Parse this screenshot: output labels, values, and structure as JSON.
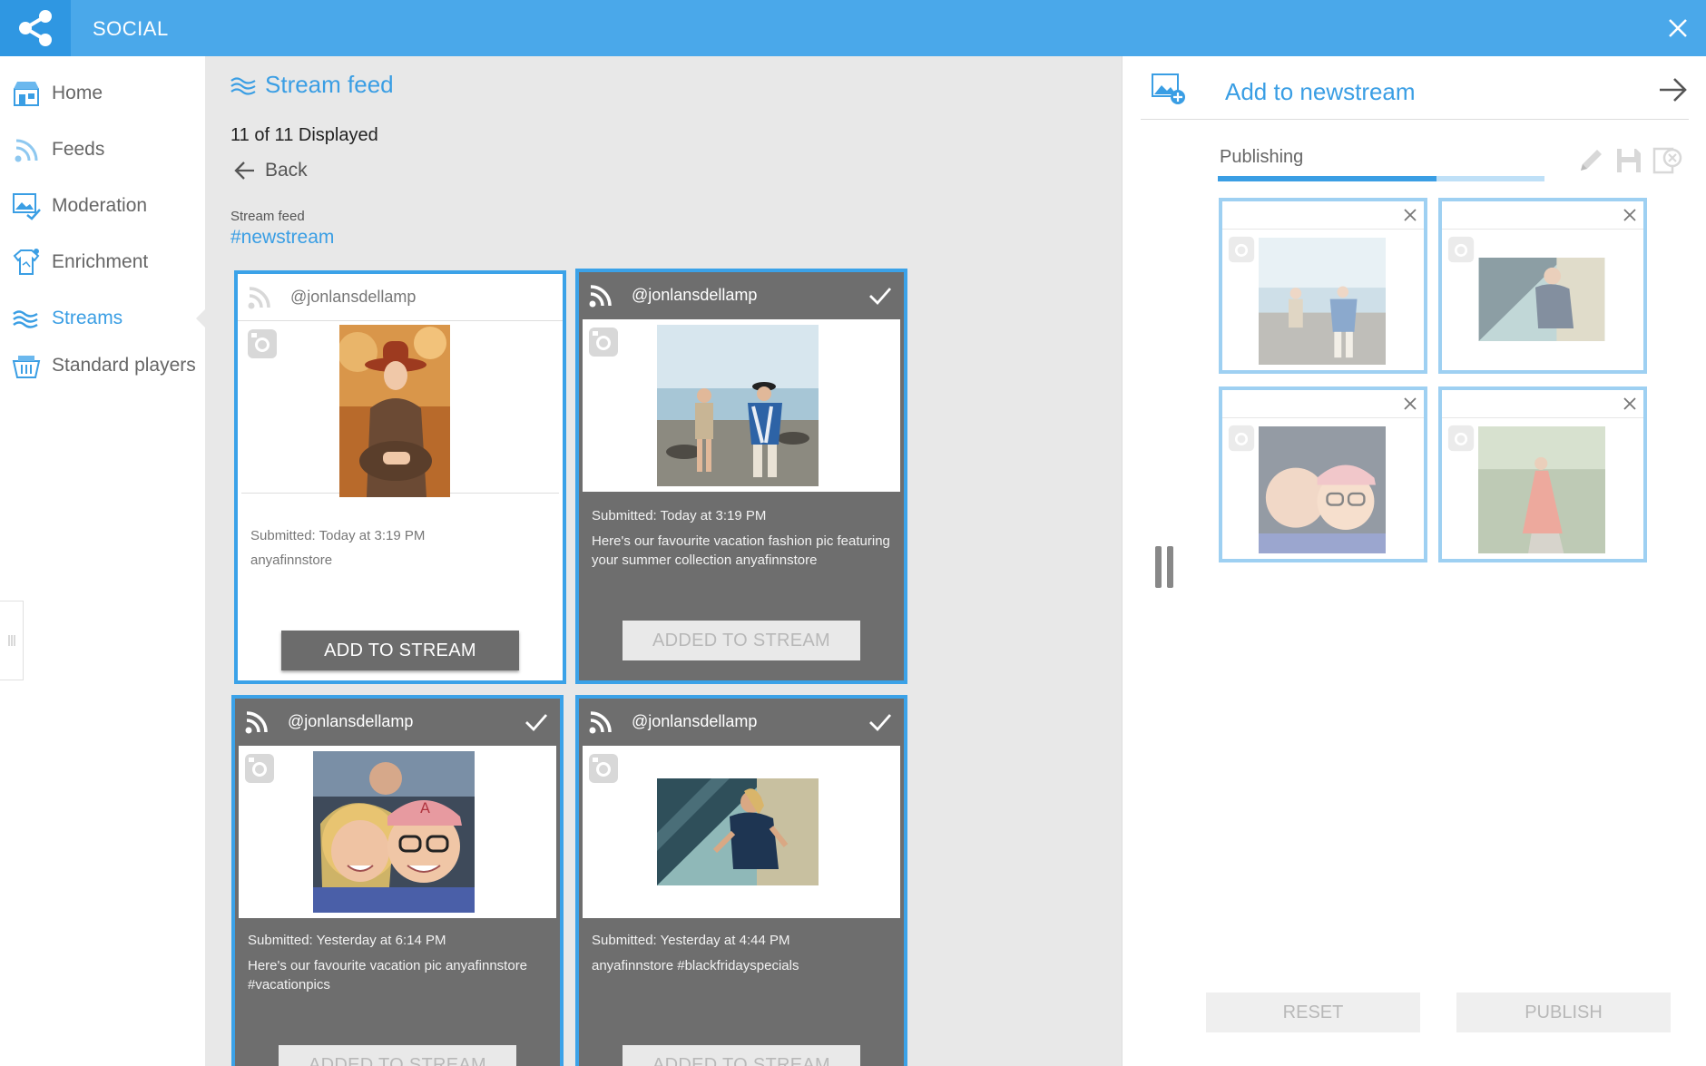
{
  "app": {
    "title": "SOCIAL"
  },
  "sidebar": {
    "items": [
      {
        "label": "Home",
        "icon": "store-icon"
      },
      {
        "label": "Feeds",
        "icon": "rss-icon"
      },
      {
        "label": "Moderation",
        "icon": "image-check-icon"
      },
      {
        "label": "Enrichment",
        "icon": "shirt-enrich-icon"
      },
      {
        "label": "Streams",
        "icon": "waves-icon",
        "active": true
      },
      {
        "label": "Standard players",
        "icon": "basket-icon"
      }
    ]
  },
  "main": {
    "title": "Stream feed",
    "count_text": "11 of 11 Displayed",
    "back_label": "Back",
    "feed_label": "Stream feed",
    "feed_tag": "#newstream",
    "cards": [
      {
        "handle": "@jonlansdellamp",
        "submitted": "Submitted: Today at 3:19 PM",
        "caption": "anyafinnstore",
        "button": "ADD TO STREAM",
        "added": false
      },
      {
        "handle": "@jonlansdellamp",
        "submitted": "Submitted: Today at 3:19 PM",
        "caption": "Here's our favourite vacation fashion pic featuring your summer collection anyafinnstore",
        "button": "ADDED TO STREAM",
        "added": true
      },
      {
        "handle": "@jonlansdellamp",
        "submitted": "Submitted: Yesterday at 6:14 PM",
        "caption": "Here's our favourite vacation pic anyafinnstore #vacationpics",
        "button": "ADDED TO STREAM",
        "added": true
      },
      {
        "handle": "@jonlansdellamp",
        "submitted": "Submitted: Yesterday at 4:44 PM",
        "caption": "anyafinnstore #blackfridayspecials",
        "button": "ADDED TO STREAM",
        "added": true
      }
    ]
  },
  "panel": {
    "title": "Add to newstream",
    "publishing_label": "Publishing",
    "publishing_progress": 0.67,
    "reset_label": "RESET",
    "publish_label": "PUBLISH"
  },
  "colors": {
    "accent": "#3a9ee4",
    "topbar": "#4aa8ea",
    "card_dark": "#6e6e6e"
  }
}
